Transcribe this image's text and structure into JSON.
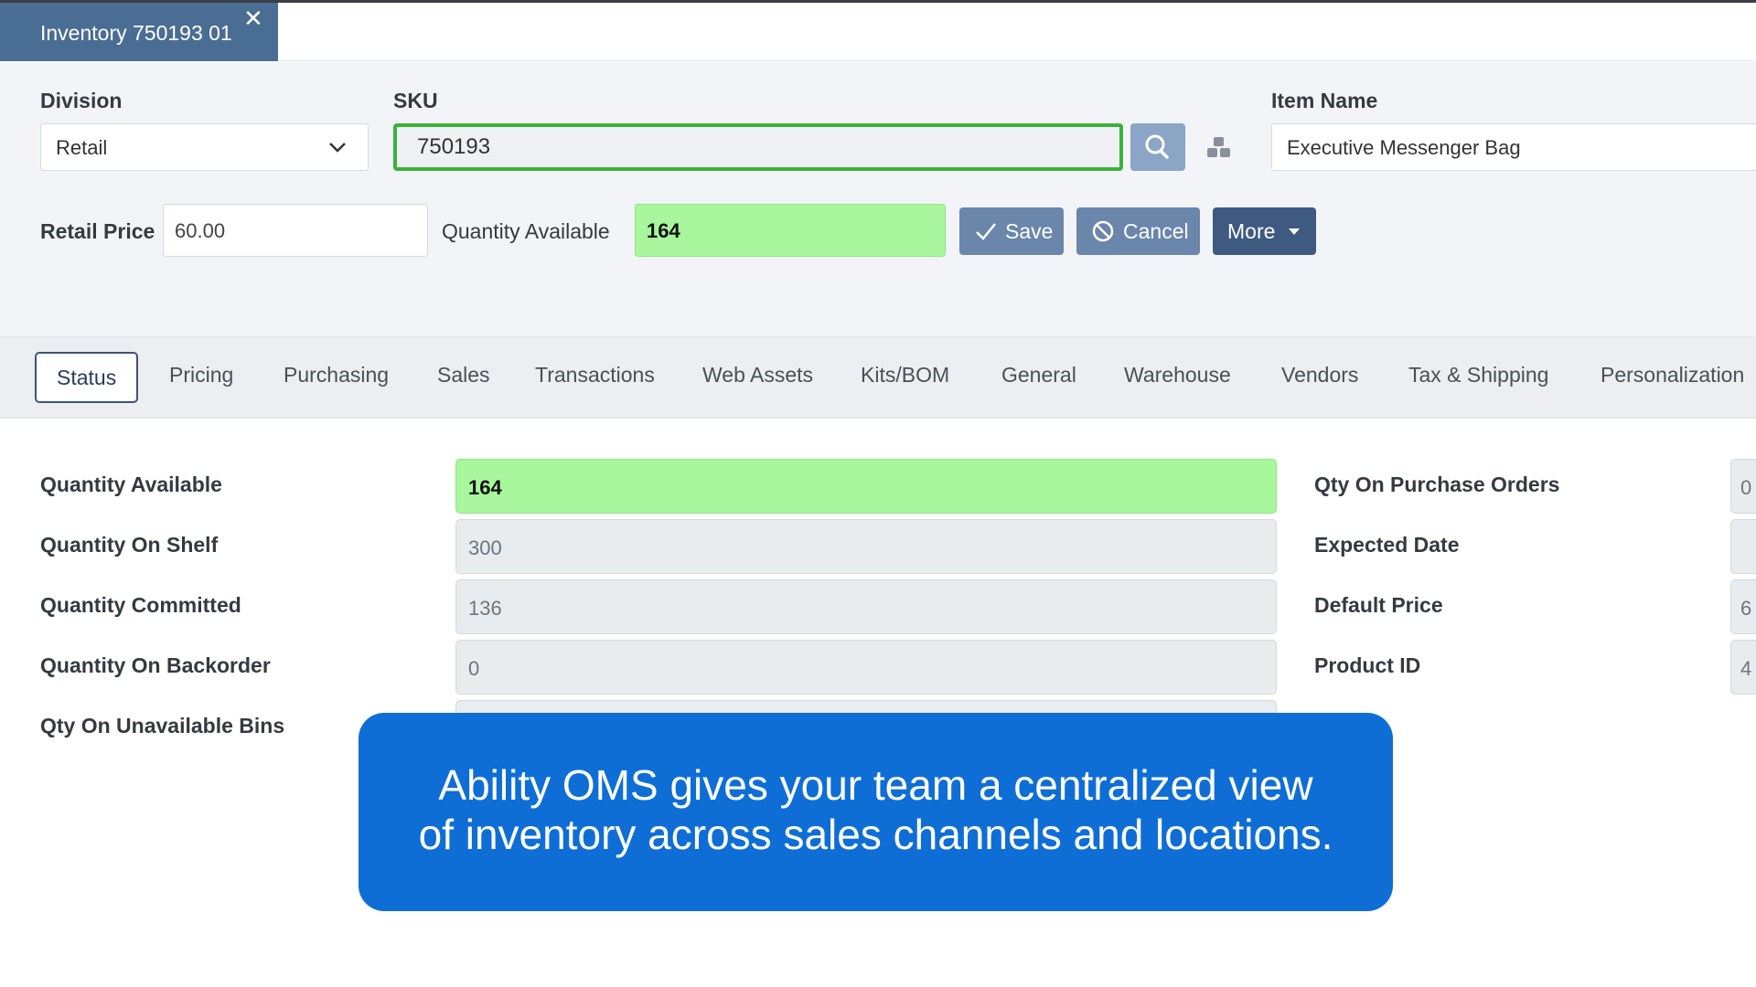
{
  "tab": {
    "title": "Inventory 750193 01",
    "close": "✕"
  },
  "header": {
    "division_label": "Division",
    "division_value": "Retail",
    "sku_label": "SKU",
    "sku_value": "750193",
    "item_name_label": "Item Name",
    "item_name_value": "Executive Messenger Bag",
    "retail_price_label": "Retail Price",
    "retail_price_value": "60.00",
    "qty_available_label": "Quantity Available",
    "qty_available_value": "164",
    "save_label": "Save",
    "cancel_label": "Cancel",
    "more_label": "More"
  },
  "tabs": [
    "Status",
    "Pricing",
    "Purchasing",
    "Sales",
    "Transactions",
    "Web Assets",
    "Kits/BOM",
    "General",
    "Warehouse",
    "Vendors",
    "Tax & Shipping",
    "Personalization"
  ],
  "status": {
    "rows": [
      {
        "label": "Quantity Available",
        "value": "164"
      },
      {
        "label": "Quantity On Shelf",
        "value": "300"
      },
      {
        "label": "Quantity Committed",
        "value": "136"
      },
      {
        "label": "Quantity On Backorder",
        "value": "0"
      },
      {
        "label": "Qty On Unavailable Bins",
        "value": ""
      }
    ],
    "right_rows": [
      {
        "label": "Qty On Purchase Orders",
        "value": "0"
      },
      {
        "label": "Expected Date",
        "value": ""
      },
      {
        "label": "Default Price",
        "value": "6"
      },
      {
        "label": "Product ID",
        "value": "4"
      }
    ]
  },
  "caption": {
    "line1": "Ability OMS gives your team a centralized view",
    "line2": "of inventory across sales channels and locations."
  },
  "colors": {
    "accent": "#4a6d94",
    "qty_green": "#a8f79d",
    "sku_border": "#3ab23a",
    "caption_bg": "#0f6ed6"
  },
  "icons": {
    "search": "search-icon",
    "cubes": "cubes-icon",
    "save": "check-icon",
    "cancel": "ban-icon",
    "more": "caret-down-icon",
    "division": "chevron-down-icon"
  }
}
